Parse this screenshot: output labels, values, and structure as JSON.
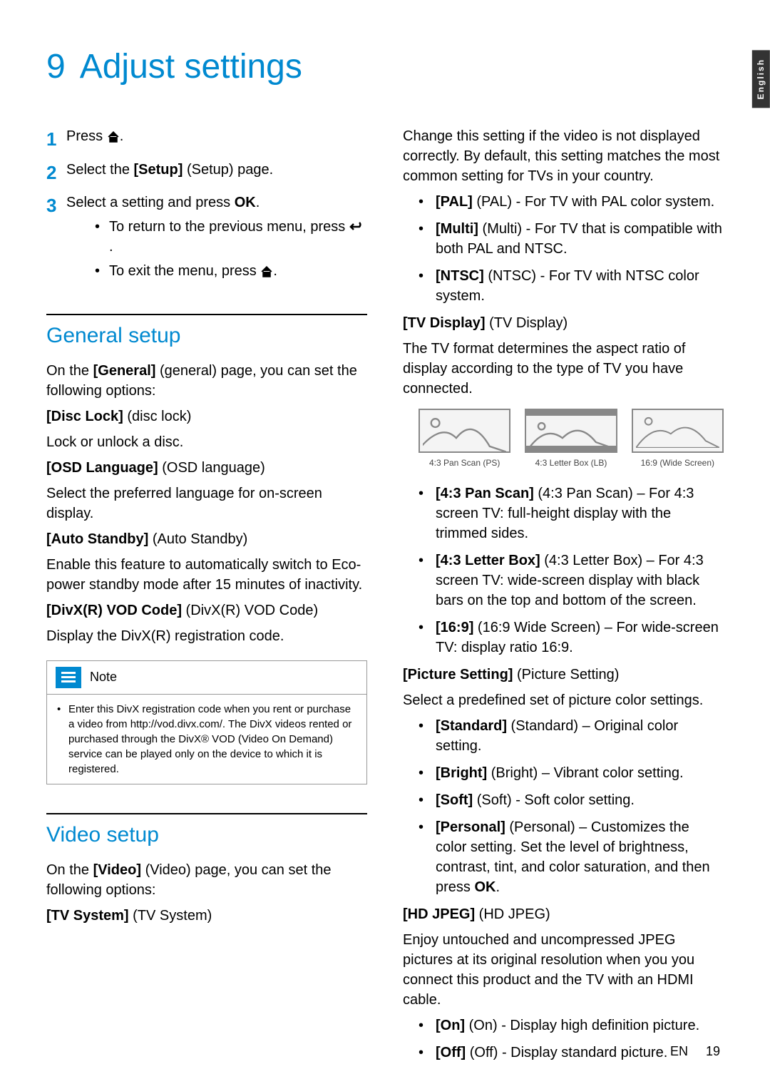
{
  "side_tab": "English",
  "chapter": {
    "number": "9",
    "title": "Adjust settings"
  },
  "steps": {
    "s1": "Press ",
    "s2_a": "Select the ",
    "s2_b": "[Setup]",
    "s2_c": " (Setup) page.",
    "s3_a": "Select a setting and press ",
    "s3_b": "OK",
    "s3_bullet1": "To return to the previous menu, press ",
    "s3_bullet2": "To exit the menu, press "
  },
  "general": {
    "heading": "General setup",
    "intro_a": "On the ",
    "intro_b": "[General]",
    "intro_c": " (general) page, you can set the following options:",
    "disclock_label": "[Disc Lock]",
    "disclock_paren": " (disc lock)",
    "disclock_desc": "Lock or unlock a disc.",
    "osd_label": "[OSD Language]",
    "osd_paren": " (OSD language)",
    "osd_desc": "Select the preferred language for on-screen display.",
    "auto_label": "[Auto Standby]",
    "auto_paren": " (Auto Standby)",
    "auto_desc": "Enable this feature to automatically switch to Eco-power standby mode after 15 minutes of inactivity.",
    "divx_label": "[DivX(R) VOD Code]",
    "divx_paren": " (DivX(R) VOD Code)",
    "divx_desc": "Display the DivX(R) registration code."
  },
  "note": {
    "title": "Note",
    "body": "Enter this DivX registration code when you rent or purchase a video from http://vod.divx.com/. The DivX videos rented or purchased through the DivX® VOD (Video On Demand) service can be played only on the device to which it is registered."
  },
  "video": {
    "heading": "Video setup",
    "intro_a": "On the ",
    "intro_b": "[Video]",
    "intro_c": " (Video) page, you can set the following options:",
    "tvsys_label": "[TV System]",
    "tvsys_paren": " (TV System)",
    "tvsys_desc": "Change this setting if the video is not displayed correctly. By default, this setting matches the most common setting for TVs in your country.",
    "pal_b": "[PAL]",
    "pal": " (PAL) - For TV with PAL color system.",
    "multi_b": "[Multi]",
    "multi": " (Multi) - For TV that is compatible with both PAL and NTSC.",
    "ntsc_b": "[NTSC]",
    "ntsc": " (NTSC) - For TV with NTSC color system.",
    "tvdisp_label": "[TV Display]",
    "tvdisp_paren": " (TV Display)",
    "tvdisp_desc": "The TV format determines the aspect ratio of display according to the type of TV you have connected.",
    "img1": "4:3 Pan Scan (PS)",
    "img2": "4:3 Letter Box (LB)",
    "img3": "16:9 (Wide Screen)",
    "ps_b": "[4:3 Pan Scan]",
    "ps": " (4:3 Pan Scan) – For 4:3 screen TV: full-height display with the trimmed sides.",
    "lb_b": "[4:3 Letter Box]",
    "lb": " (4:3 Letter Box) – For 4:3 screen TV: wide-screen display with black bars on the top and bottom of the screen.",
    "ws_b": "[16:9]",
    "ws": " (16:9 Wide Screen) – For wide-screen TV: display ratio 16:9.",
    "pic_label": "[Picture Setting]",
    "pic_paren": " (Picture Setting)",
    "pic_desc": "Select a predefined set of picture color settings.",
    "std_b": "[Standard]",
    "std": " (Standard) – Original color setting.",
    "bright_b": "[Bright]",
    "bright": " (Bright) – Vibrant color setting.",
    "soft_b": "[Soft]",
    "soft": " (Soft) - Soft color setting.",
    "pers_b": "[Personal]",
    "pers_a": " (Personal) – Customizes the color setting. Set the level of brightness, contrast, tint, and color saturation, and then press ",
    "pers_c": "OK",
    "pers_d": ".",
    "hd_label": "[HD JPEG]",
    "hd_paren": " (HD JPEG)",
    "hd_desc": "Enjoy untouched and uncompressed JPEG pictures at its original resolution when you you connect this product and the TV with an HDMI cable.",
    "on_b": "[On]",
    "on": " (On) - Display high definition picture.",
    "off_b": "[Off]",
    "off": " (Off) - Display standard picture."
  },
  "footer": {
    "lang": "EN",
    "page": "19"
  }
}
